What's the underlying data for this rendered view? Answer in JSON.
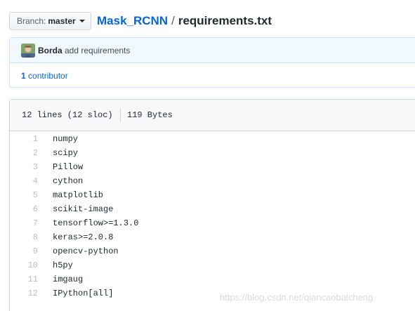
{
  "branch": {
    "prefix": "Branch:",
    "name": "master"
  },
  "breadcrumb": {
    "repo": "Mask_RCNN",
    "separator": "/",
    "file": "requirements.txt"
  },
  "commit": {
    "author": "Borda",
    "message": "add requirements"
  },
  "contributors": {
    "count": "1",
    "label": "contributor"
  },
  "file": {
    "lines_info": "12 lines (12 sloc)",
    "size": "119 Bytes",
    "lines": [
      {
        "num": "1",
        "code": "numpy"
      },
      {
        "num": "2",
        "code": "scipy"
      },
      {
        "num": "3",
        "code": "Pillow"
      },
      {
        "num": "4",
        "code": "cython"
      },
      {
        "num": "5",
        "code": "matplotlib"
      },
      {
        "num": "6",
        "code": "scikit-image"
      },
      {
        "num": "7",
        "code": "tensorflow>=1.3.0"
      },
      {
        "num": "8",
        "code": "keras>=2.0.8"
      },
      {
        "num": "9",
        "code": "opencv-python"
      },
      {
        "num": "10",
        "code": "h5py"
      },
      {
        "num": "11",
        "code": "imgaug"
      },
      {
        "num": "12",
        "code": "IPython[all]"
      }
    ]
  },
  "watermark": "https://blog.csdn.net/qiancaobaicheng",
  "colors": {
    "link": "#0366d6",
    "commit_bg": "#f1f8ff",
    "header_bg": "#f6f8fa"
  }
}
